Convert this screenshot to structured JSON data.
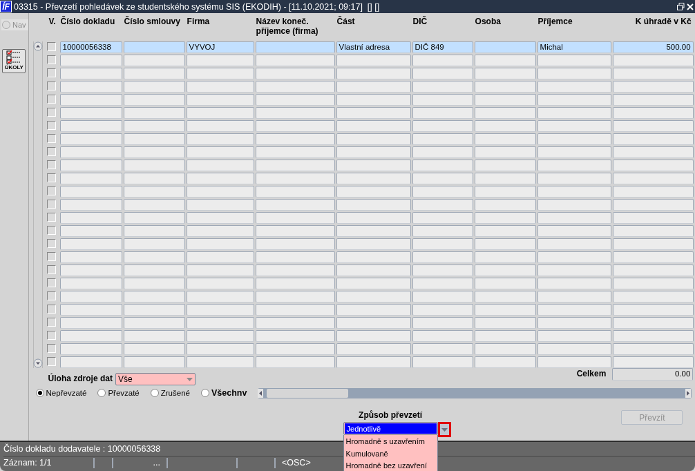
{
  "window": {
    "logo": "ÍF",
    "title": "03315 - Převzetí pohledávek ze studentského systému SIS (EKODIH) - [11.10.2021; 09:17]  [] []"
  },
  "nav": {
    "label": "Nav",
    "selected": false,
    "disabled": true
  },
  "tasks_button": {
    "label": "ÚKOLY"
  },
  "table": {
    "columns": [
      {
        "label": "V.",
        "kind": "check"
      },
      {
        "label": "Číslo dokladu",
        "kind": "text"
      },
      {
        "label": "Číslo smlouvy",
        "kind": "text"
      },
      {
        "label": "Firma",
        "kind": "text"
      },
      {
        "label": "Název koneč. příjemce (firma)",
        "kind": "text"
      },
      {
        "label": "Část",
        "kind": "text"
      },
      {
        "label": "DIČ",
        "kind": "text"
      },
      {
        "label": "Osoba",
        "kind": "text"
      },
      {
        "label": "Příjemce",
        "kind": "text"
      },
      {
        "label": "K úhradě v Kč",
        "kind": "number"
      }
    ],
    "rows": [
      {
        "checked": false,
        "selected": true,
        "cells": [
          "10000056338",
          null,
          "VYVOJ",
          null,
          "Vlastní adresa",
          "DIČ 849",
          null,
          "Michal",
          "500.00"
        ]
      },
      {
        "checked": false,
        "selected": false
      },
      {
        "checked": false,
        "selected": false
      },
      {
        "checked": false,
        "selected": false
      },
      {
        "checked": false,
        "selected": false
      },
      {
        "checked": false,
        "selected": false
      },
      {
        "checked": false,
        "selected": false
      },
      {
        "checked": false,
        "selected": false
      },
      {
        "checked": false,
        "selected": false
      },
      {
        "checked": false,
        "selected": false
      },
      {
        "checked": false,
        "selected": false
      },
      {
        "checked": false,
        "selected": false
      },
      {
        "checked": false,
        "selected": false
      },
      {
        "checked": false,
        "selected": false
      },
      {
        "checked": false,
        "selected": false
      },
      {
        "checked": false,
        "selected": false
      },
      {
        "checked": false,
        "selected": false
      },
      {
        "checked": false,
        "selected": false
      },
      {
        "checked": false,
        "selected": false
      },
      {
        "checked": false,
        "selected": false
      },
      {
        "checked": false,
        "selected": false
      },
      {
        "checked": false,
        "selected": false
      },
      {
        "checked": false,
        "selected": false
      },
      {
        "checked": false,
        "selected": false
      },
      {
        "checked": false,
        "selected": false
      }
    ],
    "total": {
      "label": "Celkem",
      "value": "0.00"
    }
  },
  "source_filter": {
    "label": "Úloha zdroje dat",
    "value": "Vše"
  },
  "state_filter": [
    {
      "label": "Nepřevzaté",
      "selected": true,
      "bold": false
    },
    {
      "label": "Převzaté",
      "selected": false,
      "bold": false
    },
    {
      "label": "Zrušené",
      "selected": false,
      "bold": false
    },
    {
      "label": "Všechnv",
      "selected": false,
      "bold": true
    }
  ],
  "method": {
    "label": "Způsob převzetí",
    "expanded": true,
    "options": [
      {
        "label": "Jednotlivě",
        "selected": true
      },
      {
        "label": "Hromadně s uzavřením",
        "selected": false
      },
      {
        "label": "Kumulovaně",
        "selected": false
      },
      {
        "label": "Hromadně bez uzavření",
        "selected": false
      }
    ]
  },
  "take_button": {
    "label": "Převzít",
    "disabled": true
  },
  "status_bar": {
    "message": "Číslo dokladu dodavatele : 10000056338",
    "record": "Záznam: 1/1",
    "segments": [
      "...",
      "<OSC>"
    ]
  }
}
